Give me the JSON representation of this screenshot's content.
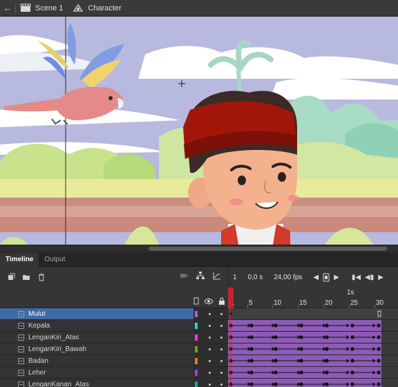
{
  "breadcrumb": {
    "scene_label": "Scene 1",
    "symbol_label": "Character"
  },
  "panel_tabs": [
    {
      "label": "Timeline",
      "active": true
    },
    {
      "label": "Output",
      "active": false
    }
  ],
  "timeline_toolbar": {
    "current_frame": "1",
    "elapsed_time": "0,0 s",
    "frame_rate": "24,00 fps"
  },
  "ruler": {
    "seconds_marker": "1s",
    "frame_numbers": [
      "1",
      "5",
      "10",
      "15",
      "20",
      "25",
      "30"
    ]
  },
  "layers": [
    {
      "name": "Mulut",
      "color": "#b05cd6",
      "selected": true
    },
    {
      "name": "Kepala",
      "color": "#21d4e6",
      "selected": false
    },
    {
      "name": "LenganKiri_Atas",
      "color": "#e83ed8",
      "selected": false
    },
    {
      "name": "LenganKiri_Bawah",
      "color": "#79a21e",
      "selected": false
    },
    {
      "name": "Badan",
      "color": "#f07a18",
      "selected": false
    },
    {
      "name": "Leher",
      "color": "#9b3fe0",
      "selected": false
    },
    {
      "name": "LenganKanan_Atas",
      "color": "#1aa7a0",
      "selected": false
    }
  ],
  "colors": {
    "playhead": "#c2272d",
    "selection": "#3e6aa6",
    "tween_span": "#8d5bb7"
  }
}
